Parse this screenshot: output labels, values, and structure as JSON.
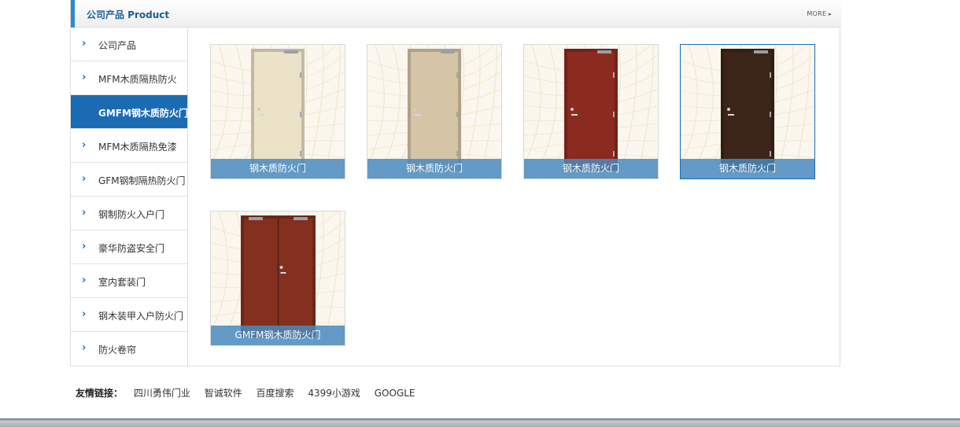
{
  "header": {
    "title": "公司产品 Product",
    "more_label": "MORE",
    "more_arrow": "▸"
  },
  "sidebar": {
    "items": [
      {
        "label": "公司产品",
        "active": false
      },
      {
        "label": "MFM木质隔热防火",
        "active": false
      },
      {
        "label": "GMFM钢木质防火门",
        "active": true
      },
      {
        "label": "MFM木质隔热免漆",
        "active": false
      },
      {
        "label": "GFM钢制隔热防火门",
        "active": false
      },
      {
        "label": "钢制防火入户门",
        "active": false
      },
      {
        "label": "豪华防盗安全门",
        "active": false
      },
      {
        "label": "室内套装门",
        "active": false
      },
      {
        "label": "钢木装甲入户防火门",
        "active": false
      },
      {
        "label": "防火卷帘",
        "active": false
      }
    ]
  },
  "products": [
    {
      "caption": "钢木质防火门",
      "color": "#ece2c7",
      "style": "single",
      "selected": false
    },
    {
      "caption": "钢木质防火门",
      "color": "#d6c4a6",
      "style": "single",
      "selected": false
    },
    {
      "caption": "钢木质防火门",
      "color": "#8b2a1e",
      "style": "single",
      "selected": false
    },
    {
      "caption": "钢木质防火门",
      "color": "#3b2519",
      "style": "single",
      "selected": true
    },
    {
      "caption": "GMFM钢木质防火门",
      "color": "#83301f",
      "style": "double",
      "selected": false
    }
  ],
  "friend_links": {
    "label": "友情链接：",
    "links": [
      "四川勇伟门业",
      "智诚软件",
      "百度搜索",
      "4399小游戏",
      "GOOGLE"
    ]
  }
}
